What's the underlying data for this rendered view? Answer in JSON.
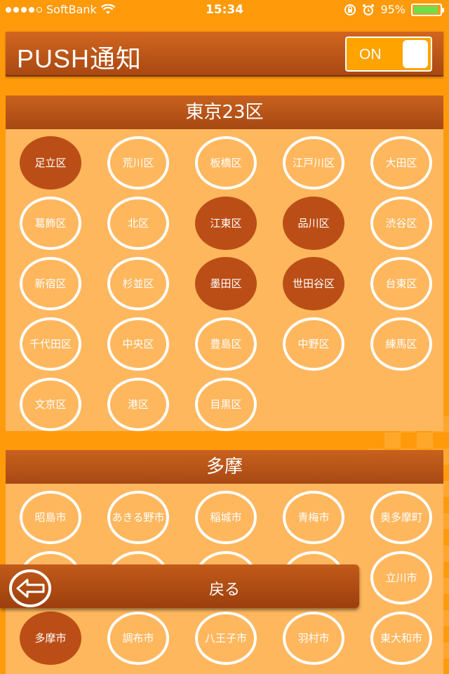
{
  "status": {
    "carrier": "SoftBank",
    "time": "15:34",
    "battery": "95%",
    "battery_level": 0.95
  },
  "header": {
    "title": "PUSH通知",
    "toggle_label": "ON"
  },
  "sections": [
    {
      "title": "東京23区",
      "items": [
        {
          "label": "足立区",
          "selected": true
        },
        {
          "label": "荒川区",
          "selected": false
        },
        {
          "label": "板橋区",
          "selected": false
        },
        {
          "label": "江戸川区",
          "selected": false
        },
        {
          "label": "大田区",
          "selected": false
        },
        {
          "label": "葛飾区",
          "selected": false
        },
        {
          "label": "北区",
          "selected": false
        },
        {
          "label": "江東区",
          "selected": true
        },
        {
          "label": "品川区",
          "selected": true
        },
        {
          "label": "渋谷区",
          "selected": false
        },
        {
          "label": "新宿区",
          "selected": false
        },
        {
          "label": "杉並区",
          "selected": false
        },
        {
          "label": "墨田区",
          "selected": true
        },
        {
          "label": "世田谷区",
          "selected": true
        },
        {
          "label": "台東区",
          "selected": false
        },
        {
          "label": "千代田区",
          "selected": false
        },
        {
          "label": "中央区",
          "selected": false
        },
        {
          "label": "豊島区",
          "selected": false
        },
        {
          "label": "中野区",
          "selected": false
        },
        {
          "label": "練馬区",
          "selected": false
        },
        {
          "label": "文京区",
          "selected": false
        },
        {
          "label": "港区",
          "selected": false
        },
        {
          "label": "目黒区",
          "selected": false
        }
      ]
    },
    {
      "title": "多摩",
      "items": [
        {
          "label": "昭島市",
          "selected": false
        },
        {
          "label": "あきる野市",
          "selected": false
        },
        {
          "label": "稲城市",
          "selected": false
        },
        {
          "label": "青梅市",
          "selected": false
        },
        {
          "label": "奥多摩町",
          "selected": false
        },
        {
          "label": "",
          "selected": false
        },
        {
          "label": "",
          "selected": false
        },
        {
          "label": "",
          "selected": false
        },
        {
          "label": "",
          "selected": false
        },
        {
          "label": "立川市",
          "selected": false
        },
        {
          "label": "多摩市",
          "selected": true
        },
        {
          "label": "調布市",
          "selected": false
        },
        {
          "label": "八王子市",
          "selected": false
        },
        {
          "label": "羽村市",
          "selected": false
        },
        {
          "label": "東大和市",
          "selected": false
        }
      ]
    }
  ],
  "back": {
    "label": "戻る",
    "icon": "back-arrow-icon"
  }
}
